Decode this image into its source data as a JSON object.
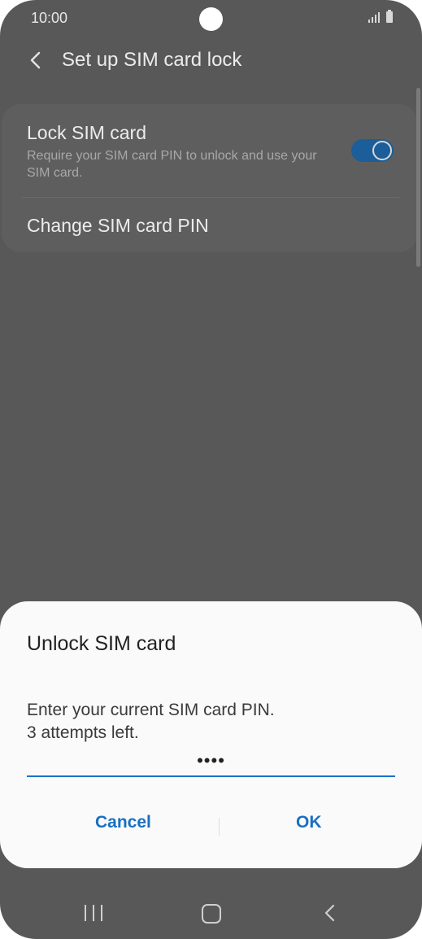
{
  "status_bar": {
    "time": "10:00",
    "signal_icon": "signal-icon",
    "battery_icon": "battery-icon"
  },
  "header": {
    "title": "Set up SIM card lock",
    "back_icon": "back-arrow-icon"
  },
  "settings": {
    "lock_sim": {
      "title": "Lock SIM card",
      "description": "Require your SIM card PIN to unlock and use your SIM card.",
      "toggle_on": true
    },
    "change_pin": {
      "title": "Change SIM card PIN"
    }
  },
  "dialog": {
    "title": "Unlock SIM card",
    "message_line1": "Enter your current SIM card PIN.",
    "message_line2": "3 attempts left.",
    "pin_value": "••••",
    "cancel_label": "Cancel",
    "ok_label": "OK"
  },
  "navigation_bar": {
    "recent_icon": "recent-apps-icon",
    "home_icon": "home-icon",
    "back_icon": "back-icon"
  },
  "colors": {
    "accent": "#1a6fc2",
    "toggle": "#1b5e99",
    "scrim_background": "#585858"
  }
}
